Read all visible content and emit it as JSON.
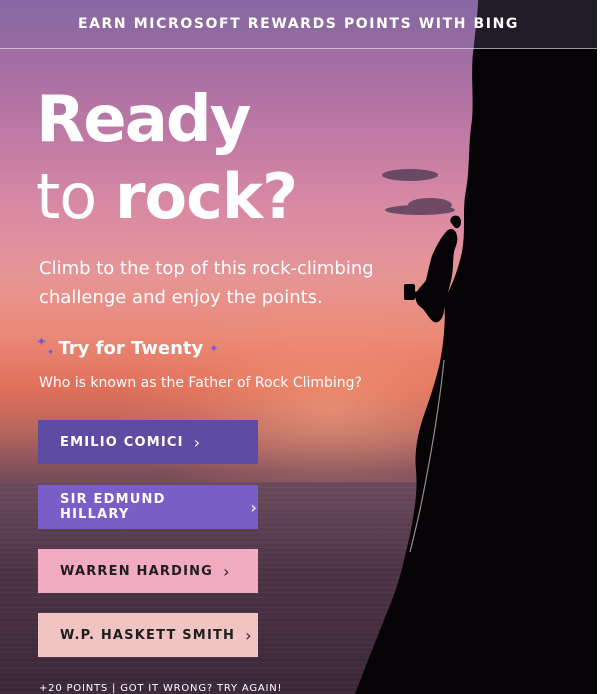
{
  "banner": {
    "text": "EARN MICROSOFT REWARDS POINTS WITH BING"
  },
  "headline": {
    "line1": "Ready",
    "line2_light": "to",
    "line2_bold": "rock?"
  },
  "subhead": {
    "line1": "Climb to the top of this rock-climbing",
    "line2": "challenge and enjoy the points."
  },
  "quiz": {
    "title": "Try for Twenty",
    "question": "Who is known as the Father of Rock Climbing?",
    "answers": [
      {
        "label": "EMILIO COMICI",
        "color": "#5e4ba3"
      },
      {
        "label": "SIR EDMUND HILLARY",
        "color": "#7a5ec7"
      },
      {
        "label": "WARREN HARDING",
        "color": "#f1aac0"
      },
      {
        "label": "W.P. HASKETT SMITH",
        "color": "#f1c4c4"
      }
    ],
    "chevron": "›"
  },
  "footer": {
    "text": "+20 POINTS | GOT IT WRONG? TRY AGAIN!"
  },
  "icons": {
    "sparkle": "✦",
    "chevron": "chevron-right-icon"
  },
  "colors": {
    "accent": "#6f5bd8",
    "sky_top": "#8c6aa6",
    "sunset": "#e0705a",
    "silhouette": "#050305"
  }
}
